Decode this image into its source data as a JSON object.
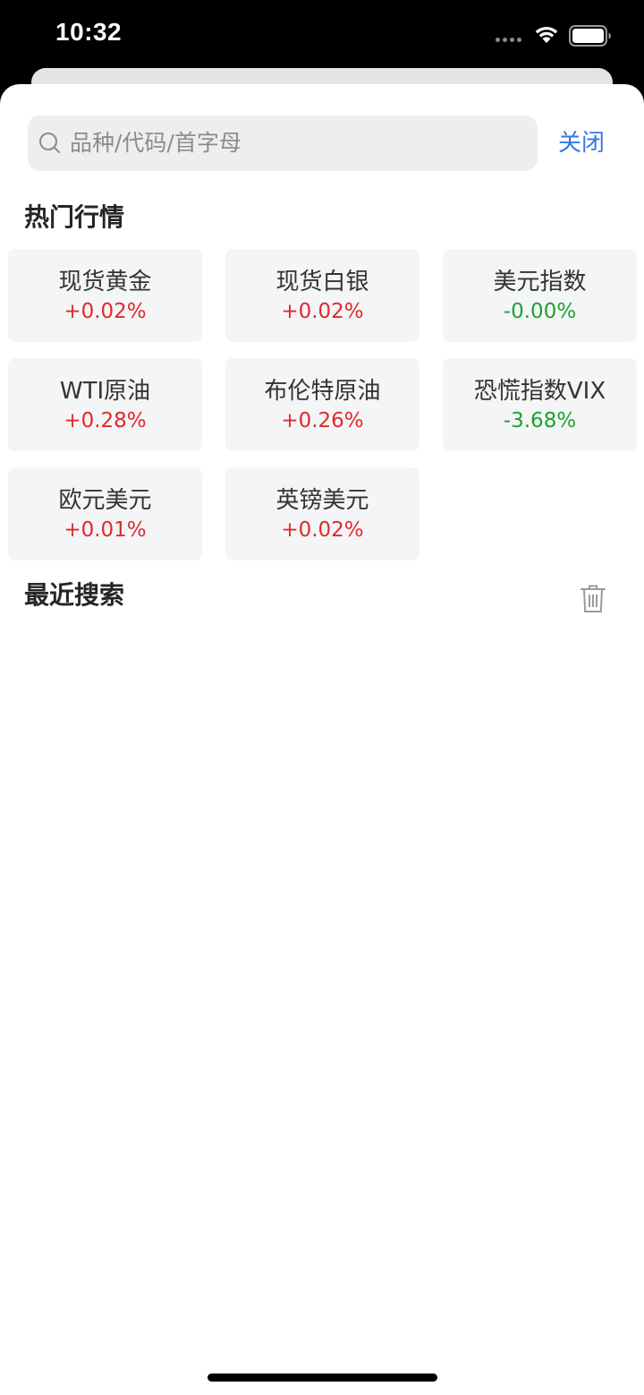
{
  "status_bar": {
    "time": "10:32"
  },
  "search": {
    "placeholder": "品种/代码/首字母",
    "close_label": "关闭"
  },
  "hot": {
    "title": "热门行情",
    "items": [
      {
        "name": "现货黄金",
        "change": "+0.02%",
        "direction": "up"
      },
      {
        "name": "现货白银",
        "change": "+0.02%",
        "direction": "up"
      },
      {
        "name": "美元指数",
        "change": "-0.00%",
        "direction": "down"
      },
      {
        "name": "WTI原油",
        "change": "+0.28%",
        "direction": "up"
      },
      {
        "name": "布伦特原油",
        "change": "+0.26%",
        "direction": "up"
      },
      {
        "name": "恐慌指数VIX",
        "change": "-3.68%",
        "direction": "down"
      },
      {
        "name": "欧元美元",
        "change": "+0.01%",
        "direction": "up"
      },
      {
        "name": "英镑美元",
        "change": "+0.02%",
        "direction": "up"
      }
    ]
  },
  "recent": {
    "title": "最近搜索"
  },
  "colors": {
    "up": "#e02a2a",
    "down": "#1da32b",
    "accent": "#3478e6"
  },
  "icons": [
    "search-icon",
    "wifi-icon",
    "battery-icon",
    "trash-icon"
  ]
}
